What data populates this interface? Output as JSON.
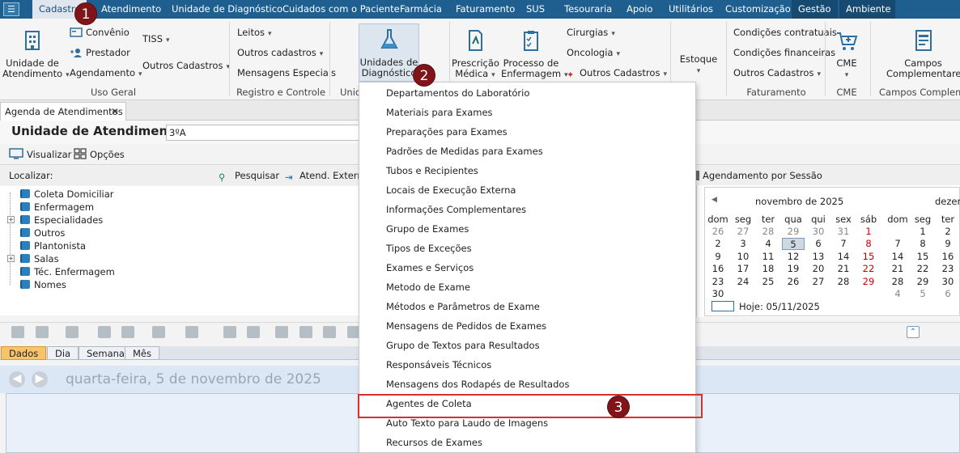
{
  "menubar": {
    "items": [
      {
        "label": "Cadastro"
      },
      {
        "label": "Atendimento"
      },
      {
        "label": "Unidade de Diagnóstico"
      },
      {
        "label": "Cuidados com o Paciente"
      },
      {
        "label": "Farmácia"
      },
      {
        "label": "Faturamento"
      },
      {
        "label": "SUS"
      },
      {
        "label": "Tesouraria"
      },
      {
        "label": "Apoio"
      },
      {
        "label": "Utilitários"
      },
      {
        "label": "Customização"
      },
      {
        "label": "Gestão"
      },
      {
        "label": "Ambiente"
      }
    ]
  },
  "ribbon": {
    "uso_geral": {
      "unidade_atendimento": "Unidade de",
      "unidade_atendimento2": "Atendimento",
      "convenio": "Convênio",
      "prestador": "Prestador",
      "agendamento": "Agendamento",
      "tiss": "TISS",
      "outros_cadastros": "Outros Cadastros",
      "group": "Uso Geral"
    },
    "registro": {
      "leitos": "Leitos",
      "outros_cadastros": "Outros cadastros",
      "mensagens_especiais": "Mensagens Especiais",
      "group": "Registro e Controle"
    },
    "diagnostico": {
      "label1": "Unidades de",
      "label2": "Diagnóstico",
      "group": "Unid"
    },
    "prescricao": {
      "label1": "Prescrição",
      "label2": "Médica"
    },
    "processo": {
      "label1": "Processo de",
      "label2": "Enfermagem"
    },
    "cirurgias": "Cirurgias",
    "oncologia": "Oncologia",
    "outros_cadastros": "Outros Cadastros",
    "estoque": {
      "label": "Estoque"
    },
    "faturamento": {
      "condicoes_contratuais": "Condições contratuais",
      "condicoes_financeiras": "Condições financeiras",
      "outros_cadastros": "Outros Cadastros",
      "group": "Faturamento"
    },
    "cme": {
      "label": "CME",
      "group": "CME"
    },
    "campos": {
      "label1": "Campos",
      "label2": "Complementares",
      "group": "Campos Complemen"
    }
  },
  "doc_tab": {
    "label": "Agenda de Atendimentos"
  },
  "unit": {
    "title": "Unidade de Atendimento",
    "value": "3ºA"
  },
  "viewbar": {
    "visualizar": "Visualizar",
    "opcoes": "Opções"
  },
  "searchbar": {
    "localizar": "Localizar:",
    "pesquisar": "Pesquisar",
    "atend_externo": "Atend. Extern",
    "agendamento_sessao": "Agendamento por Sessão"
  },
  "tree": {
    "items": [
      {
        "label": "Coleta Domiciliar"
      },
      {
        "label": "Enfermagem"
      },
      {
        "label": "Especialidades"
      },
      {
        "label": "Outros"
      },
      {
        "label": "Plantonista"
      },
      {
        "label": "Salas"
      },
      {
        "label": "Téc. Enfermagem"
      },
      {
        "label": "Nomes"
      }
    ]
  },
  "calendar": {
    "month1": "novembro de 2025",
    "month2": "dezem",
    "weekday_headers": [
      "dom",
      "seg",
      "ter",
      "qua",
      "qui",
      "sex",
      "sáb",
      "dom",
      "seg",
      "ter"
    ],
    "today_label": "Hoje: 05/11/2025",
    "accent_today": "#cfd9e4",
    "month1_rows": [
      [
        "26",
        "27",
        "28",
        "29",
        "30",
        "31",
        "1"
      ],
      [
        "2",
        "3",
        "4",
        "5",
        "6",
        "7",
        "8"
      ],
      [
        "9",
        "10",
        "11",
        "12",
        "13",
        "14",
        "15"
      ],
      [
        "16",
        "17",
        "18",
        "19",
        "20",
        "21",
        "22"
      ],
      [
        "23",
        "24",
        "25",
        "26",
        "27",
        "28",
        "29"
      ],
      [
        "30",
        "",
        "",
        "",
        "",
        "",
        ""
      ]
    ],
    "month2_rows": [
      [
        "",
        "1",
        "2"
      ],
      [
        "7",
        "8",
        "9"
      ],
      [
        "14",
        "15",
        "16"
      ],
      [
        "21",
        "22",
        "23"
      ],
      [
        "28",
        "29",
        "30"
      ],
      [
        "4",
        "5",
        "6"
      ]
    ]
  },
  "viewtabs": {
    "dados": "Dados",
    "dia": "Dia",
    "semana": "Semana",
    "mes": "Mês"
  },
  "schedule": {
    "date": "quarta-feira, 5 de novembro de 2025"
  },
  "dropdown": {
    "items": [
      {
        "label": "Departamentos do Laboratório"
      },
      {
        "label": "Materiais para Exames"
      },
      {
        "label": "Preparações para Exames"
      },
      {
        "label": "Padrões de Medidas para Exames"
      },
      {
        "label": "Tubos e Recipientes"
      },
      {
        "label": "Locais de Execução Externa"
      },
      {
        "label": "Informações Complementares"
      },
      {
        "label": "Grupo de Exames"
      },
      {
        "label": "Tipos de Exceções"
      },
      {
        "label": "Exames e Serviços"
      },
      {
        "label": "Metodo de Exame"
      },
      {
        "label": "Métodos e Parâmetros de Exame"
      },
      {
        "label": "Mensagens de Pedidos de Exames"
      },
      {
        "label": "Grupo de Textos para Resultados"
      },
      {
        "label": "Responsáveis Técnicos"
      },
      {
        "label": "Mensagens dos Rodapés de Resultados"
      },
      {
        "label": "Agentes de Coleta"
      },
      {
        "label": "Auto Texto para Laudo de Imagens"
      },
      {
        "label": "Recursos de Exames"
      }
    ]
  },
  "badges": {
    "one": "1",
    "two": "2",
    "three": "3"
  },
  "colors": {
    "menubar": "#1f5f8f",
    "highlight": "#d9302f",
    "badge": "#7f1518"
  }
}
